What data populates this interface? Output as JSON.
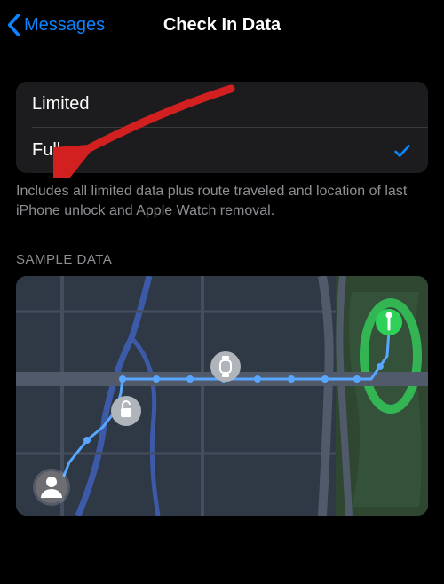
{
  "nav": {
    "back_label": "Messages",
    "title": "Check In Data"
  },
  "options": {
    "limited_label": "Limited",
    "full_label": "Full",
    "selected": "full"
  },
  "footer": "Includes all limited data plus route traveled and location of last iPhone unlock and Apple Watch removal.",
  "section_header": "SAMPLE DATA",
  "colors": {
    "accent": "#0a84ff",
    "arrow": "#d21f1f",
    "map_bg": "#2f3845",
    "road_major": "#515a6b",
    "road_minor": "#454e5e",
    "water": "#3c5aa8",
    "park": "#2f4631",
    "park_inner": "#34523a",
    "route": "#58a6ff",
    "marker_gray": "#b0b4bb",
    "marker_green": "#2fd158",
    "marker_white": "#ffffff"
  }
}
